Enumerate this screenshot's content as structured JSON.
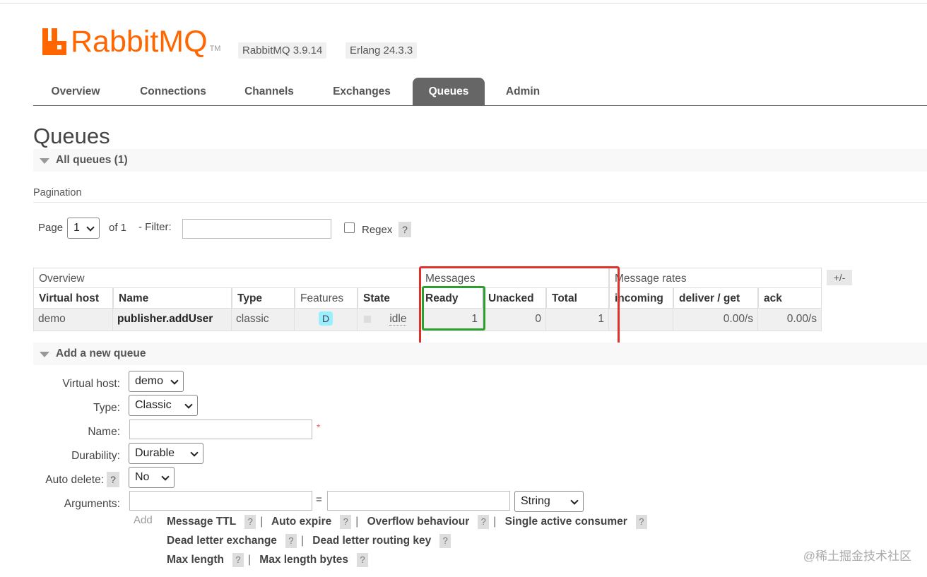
{
  "header": {
    "logo_text": "RabbitMQ",
    "logo_tm": "TM",
    "version_badges": [
      "RabbitMQ 3.9.14",
      "Erlang 24.3.3"
    ]
  },
  "tabs": [
    "Overview",
    "Connections",
    "Channels",
    "Exchanges",
    "Queues",
    "Admin"
  ],
  "active_tab": "Queues",
  "page_title": "Queues",
  "all_queues": {
    "label": "All queues (1)"
  },
  "pagination": {
    "label": "Pagination",
    "page_label": "Page",
    "page_value": "1",
    "of_label": "of 1",
    "filter_label": "- Filter:",
    "filter_value": "",
    "regex_label": "Regex",
    "help": "?"
  },
  "table": {
    "groups": [
      "Overview",
      "Messages",
      "Message rates"
    ],
    "columns": [
      "Virtual host",
      "Name",
      "Type",
      "Features",
      "State",
      "Ready",
      "Unacked",
      "Total",
      "incoming",
      "deliver / get",
      "ack"
    ],
    "toggle": "+/-",
    "rows": [
      {
        "virtual_host": "demo",
        "name": "publisher.addUser",
        "type": "classic",
        "features": "D",
        "state": "idle",
        "ready": "1",
        "unacked": "0",
        "total": "1",
        "incoming": "",
        "deliver_get": "0.00/s",
        "ack": "0.00/s"
      }
    ]
  },
  "add_queue": {
    "title": "Add a new queue",
    "fields": {
      "virtual_host": {
        "label": "Virtual host:",
        "value": "demo"
      },
      "type": {
        "label": "Type:",
        "value": "Classic"
      },
      "name": {
        "label": "Name:",
        "value": "",
        "required": "*"
      },
      "durability": {
        "label": "Durability:",
        "value": "Durable"
      },
      "auto_delete": {
        "label": "Auto delete:",
        "value": "No",
        "help": "?"
      },
      "arguments": {
        "label": "Arguments:",
        "key": "",
        "equals": "=",
        "value": "",
        "type": "String"
      }
    },
    "add_label": "Add",
    "argument_shortcuts": [
      [
        "Message TTL",
        "Auto expire",
        "Overflow behaviour",
        "Single active consumer"
      ],
      [
        "Dead letter exchange",
        "Dead letter routing key"
      ],
      [
        "Max length",
        "Max length bytes"
      ]
    ]
  },
  "watermark": "@稀土掘金技术社区",
  "colors": {
    "brand": "#ff6600",
    "highlight_red": "#e0302a",
    "highlight_green": "#2ca02c",
    "active_tab_bg": "#666666"
  },
  "icons": [
    "rabbitmq-logo-icon",
    "collapse-triangle-icon",
    "select-chevron-icon",
    "checkbox-icon",
    "durable-feature-badge"
  ]
}
